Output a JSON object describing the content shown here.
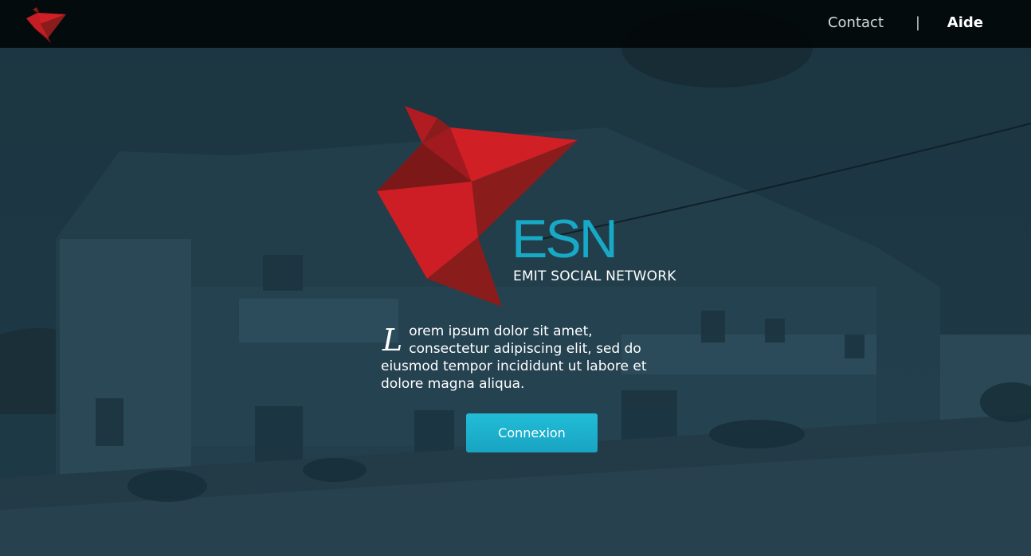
{
  "nav": {
    "contact_label": "Contact",
    "separator": "|",
    "help_label": "Aide"
  },
  "hero": {
    "brand_name": "ESN",
    "tagline": "EMIT SOCIAL NETWORK",
    "dropcap": "L",
    "intro_text": "orem ipsum dolor sit amet, consectetur adipiscing elit, sed do eiusmod tempor incididunt ut labore et dolore magna aliqua.",
    "login_button": "Connexion"
  },
  "colors": {
    "brand_teal": "#18a9c6",
    "logo_red": "#d11f26",
    "logo_dark_red": "#8a1c1c",
    "topbar": "#03080a",
    "overlay": "#1a3340"
  },
  "icons": {
    "logo": "origami-bird-logo"
  }
}
